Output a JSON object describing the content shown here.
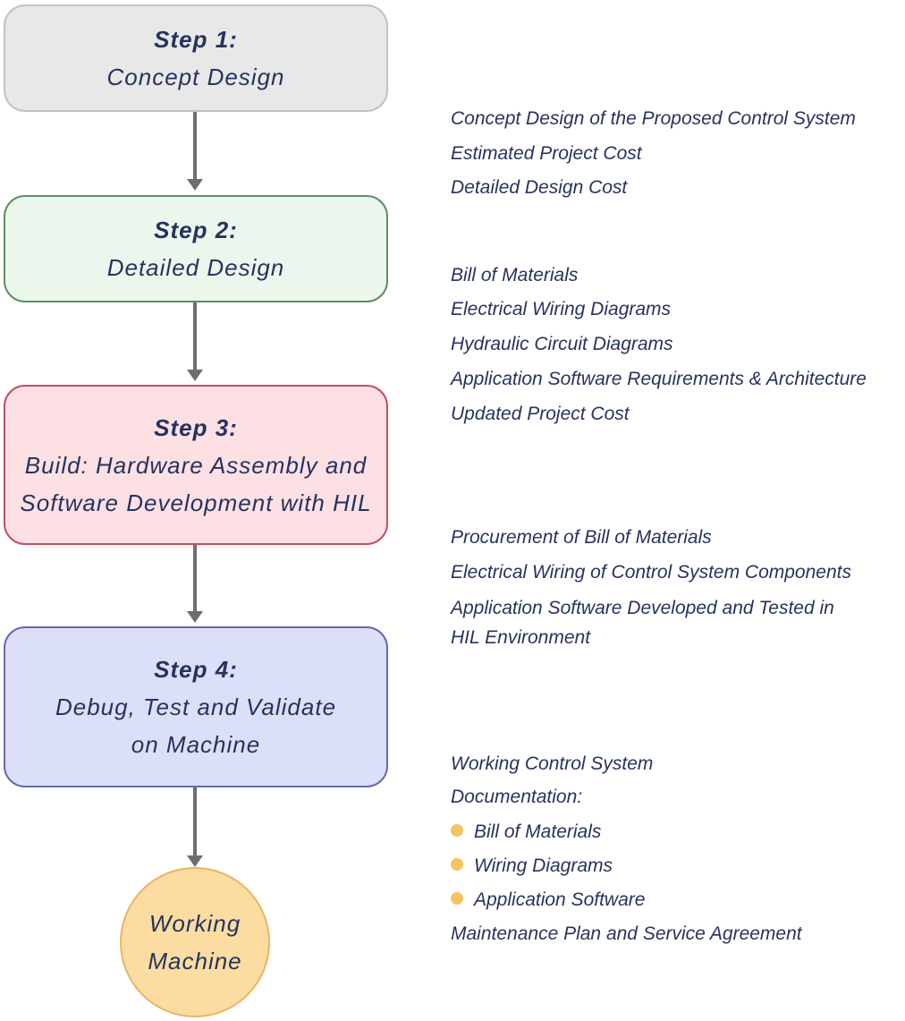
{
  "steps": [
    {
      "title": "Step 1:",
      "lines": [
        "Concept Design"
      ],
      "fill": "#e8e8e8",
      "border": "#c2c2c2"
    },
    {
      "title": "Step 2:",
      "lines": [
        "Detailed Design"
      ],
      "fill": "#ebf7ed",
      "border": "#5f8f60"
    },
    {
      "title": "Step 3:",
      "lines": [
        "Build: Hardware Assembly and",
        "Software Development with HIL"
      ],
      "fill": "#fde0e4",
      "border": "#c0505f"
    },
    {
      "title": "Step 4:",
      "lines": [
        "Debug, Test and Validate",
        "on Machine"
      ],
      "fill": "#dcdff8",
      "border": "#6469b2"
    }
  ],
  "final": {
    "lines": [
      "Working",
      "Machine"
    ],
    "fill": "#fcdca0"
  },
  "outputs": {
    "step1": [
      "Concept Design of the Proposed Control System",
      "Estimated Project Cost",
      "Detailed Design Cost"
    ],
    "step2": [
      "Bill of Materials",
      "Electrical Wiring Diagrams",
      "Hydraulic Circuit Diagrams",
      "Application Software Requirements & Architecture",
      "Updated Project Cost"
    ],
    "step3": [
      "Procurement of Bill of Materials",
      "Electrical Wiring of Control System Components",
      "Application Software Developed and Tested in",
      "HIL Environment"
    ],
    "step4": [
      "Working Control System",
      "Documentation:",
      "Bill of Materials",
      "Wiring Diagrams",
      "Application Software",
      "Maintenance Plan and Service Agreement"
    ]
  },
  "colors": {
    "text": "#26335e",
    "arrow": "#6e6e72",
    "bullet": "#f5c362"
  }
}
